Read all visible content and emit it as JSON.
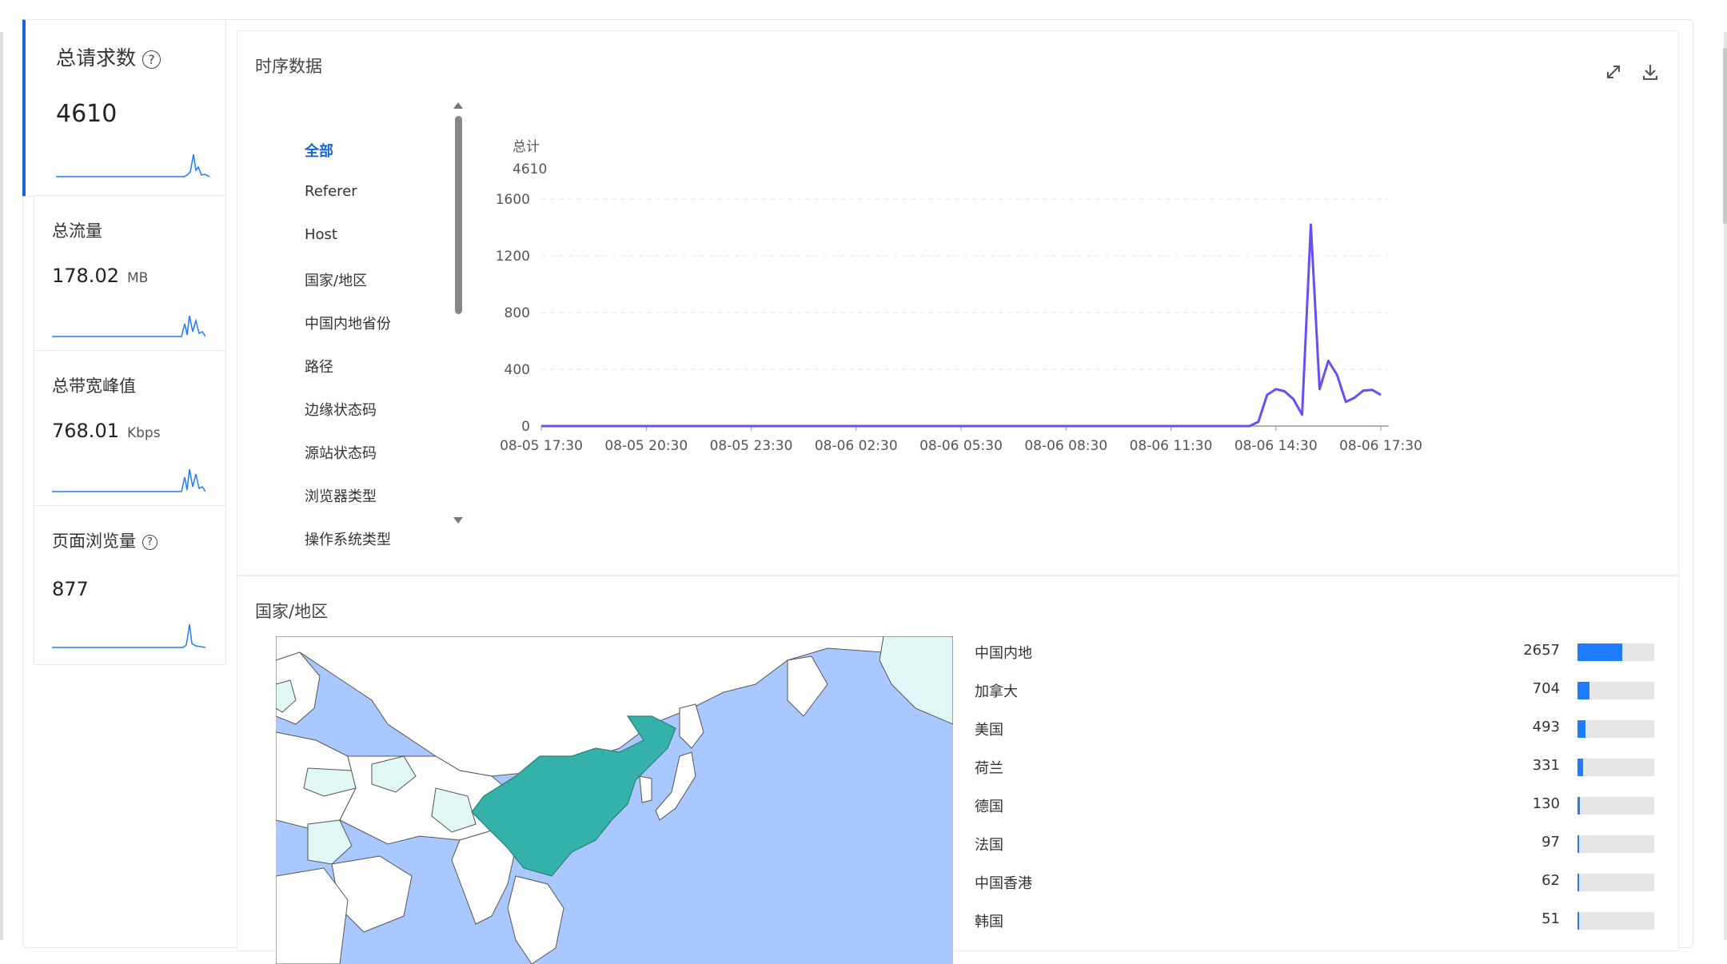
{
  "metrics": [
    {
      "label": "总请求数",
      "value": "4610",
      "unit": "",
      "help": true,
      "active": true
    },
    {
      "label": "总流量",
      "value": "178.02",
      "unit": "MB",
      "help": false,
      "active": false
    },
    {
      "label": "总带宽峰值",
      "value": "768.01",
      "unit": "Kbps",
      "help": false,
      "active": false
    },
    {
      "label": "页面浏览量",
      "value": "877",
      "unit": "",
      "help": true,
      "active": false
    }
  ],
  "timeseries_panel": {
    "title": "时序数据",
    "icons": [
      "expand-icon",
      "download-icon"
    ],
    "dimensions": [
      "全部",
      "Referer",
      "Host",
      "国家/地区",
      "中国内地省份",
      "路径",
      "边缘状态码",
      "源站状态码",
      "浏览器类型",
      "操作系统类型"
    ],
    "selected_dimension": "全部"
  },
  "chart_data": {
    "type": "line",
    "series_label": "总计",
    "series_total": "4610",
    "ylim": [
      0,
      1600
    ],
    "yticks": [
      "0",
      "400",
      "800",
      "1200",
      "1600"
    ],
    "xticks": [
      "08-05 17:30",
      "08-05 20:30",
      "08-05 23:30",
      "08-06 02:30",
      "08-06 05:30",
      "08-06 08:30",
      "08-06 11:30",
      "08-06 14:30",
      "08-06 17:30"
    ],
    "x_hours": [
      0,
      3,
      6,
      9,
      12,
      15,
      18,
      20.25,
      20.5,
      20.75,
      21,
      21.25,
      21.5,
      21.75,
      22,
      22.25,
      22.5,
      22.75,
      23,
      23.25,
      23.5,
      23.75,
      24
    ],
    "values": [
      0,
      0,
      0,
      0,
      0,
      0,
      0,
      0,
      30,
      220,
      260,
      245,
      190,
      80,
      1420,
      260,
      460,
      360,
      170,
      200,
      250,
      255,
      220
    ],
    "line_color": "#6a4ef5",
    "grid": "dashed-horizontal"
  },
  "region_panel": {
    "title": "国家/地区",
    "colors": {
      "china": "#34b1a8",
      "land": "#ffffff",
      "light_land": "#e0f7f5",
      "sea": "#a8c8ff",
      "bar": "#1f7bff"
    },
    "ranking": [
      {
        "name": "中国内地",
        "count": "2657",
        "fraction": 0.58
      },
      {
        "name": "加拿大",
        "count": "704",
        "fraction": 0.153
      },
      {
        "name": "美国",
        "count": "493",
        "fraction": 0.107
      },
      {
        "name": "荷兰",
        "count": "331",
        "fraction": 0.072
      },
      {
        "name": "德国",
        "count": "130",
        "fraction": 0.028
      },
      {
        "name": "法国",
        "count": "97",
        "fraction": 0.021
      },
      {
        "name": "中国香港",
        "count": "62",
        "fraction": 0.013
      },
      {
        "name": "韩国",
        "count": "51",
        "fraction": 0.011
      }
    ]
  }
}
